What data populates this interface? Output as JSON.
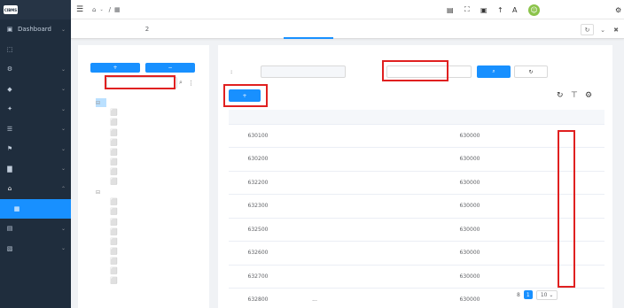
{
  "app": {
    "logo_badge": "CIBMS",
    "name": ""
  },
  "sidebar": {
    "items": [
      {
        "icon": "▣",
        "label": "Dashboard",
        "arrow": "⌄"
      },
      {
        "icon": "⬚",
        "label": ""
      },
      {
        "icon": "⚙",
        "label": "",
        "arrow": "⌄"
      },
      {
        "icon": "◆",
        "label": "",
        "arrow": "⌄"
      },
      {
        "icon": "✦",
        "label": "",
        "arrow": "⌄"
      },
      {
        "icon": "☰",
        "label": "",
        "arrow": "⌄"
      },
      {
        "icon": "⚑",
        "label": "",
        "arrow": "⌄"
      },
      {
        "icon": "▇",
        "label": "",
        "arrow": "⌄"
      },
      {
        "icon": "⌂",
        "label": "",
        "arrow": "⌃"
      },
      {
        "icon": "▦",
        "label": ""
      },
      {
        "icon": "▤",
        "label": "",
        "arrow": "⌄"
      },
      {
        "icon": "▧",
        "label": "",
        "arrow": "⌄"
      }
    ]
  },
  "topbar": {
    "menu_icon": "☰",
    "breadcrumb_home_icon": "⌂",
    "breadcrumb_parent": "",
    "breadcrumb_sep": "/",
    "breadcrumb_current_icon": "▦",
    "breadcrumb_current": "",
    "icons": [
      "▤",
      "⛶",
      "▣",
      "↑",
      "A"
    ],
    "user_avatar": "☺",
    "user_name": "",
    "settings_icon": "⚙"
  },
  "tabs": [
    {
      "label": ""
    },
    {
      "label": "2"
    },
    {
      "label": ""
    },
    {
      "label": ""
    },
    {
      "label": ""
    },
    {
      "label": ""
    },
    {
      "label": ""
    }
  ],
  "tabs_tools": [
    "↻",
    "⌄",
    "✖"
  ],
  "tree": {
    "btn_set": "+ ",
    "btn_clear": "− ",
    "filter_label": "",
    "filter_placeholder": "",
    "search_icon": "⌕",
    "more_icon": "⋮",
    "minus": "⊟",
    "file": "⬜",
    "nodes": [
      {
        "label": "",
        "level": 0
      },
      {
        "label": "",
        "level": 1
      },
      {
        "label": "",
        "level": 1
      },
      {
        "label": "",
        "level": 1
      },
      {
        "label": "",
        "level": 1
      },
      {
        "label": "",
        "level": 1
      },
      {
        "label": "",
        "level": 1
      },
      {
        "label": "",
        "level": 1
      },
      {
        "label": "",
        "level": 1
      },
      {
        "label": "",
        "level": 0
      },
      {
        "label": "",
        "level": 1
      },
      {
        "label": "",
        "level": 1
      },
      {
        "label": "",
        "level": 1
      },
      {
        "label": "",
        "level": 1
      },
      {
        "label": "",
        "level": 1
      },
      {
        "label": "",
        "level": 1
      },
      {
        "label": "",
        "level": 1
      },
      {
        "label": "",
        "level": 1
      },
      {
        "label": "",
        "level": 1
      }
    ]
  },
  "search": {
    "province_label": ":",
    "province_value": "",
    "code_label": "",
    "code_placeholder": "",
    "search_btn": "⌕ ",
    "reset_btn": "↻ "
  },
  "toolbar": {
    "add_btn": "+ ",
    "icons": [
      "↻",
      "⊤",
      "⚙"
    ]
  },
  "table": {
    "headers": [
      "",
      "",
      "",
      "",
      "",
      "",
      ""
    ],
    "rows": [
      {
        "code": "630100",
        "name": "",
        "level": "",
        "status": "",
        "parent_code": "630000",
        "parent_name": ""
      },
      {
        "code": "630200",
        "name": "",
        "level": "",
        "status": "",
        "parent_code": "630000",
        "parent_name": ""
      },
      {
        "code": "632200",
        "name": "",
        "level": "",
        "status": "",
        "parent_code": "630000",
        "parent_name": ""
      },
      {
        "code": "632300",
        "name": "",
        "level": "",
        "status": "",
        "parent_code": "630000",
        "parent_name": ""
      },
      {
        "code": "632500",
        "name": "",
        "level": "",
        "status": "",
        "parent_code": "630000",
        "parent_name": ""
      },
      {
        "code": "632600",
        "name": "",
        "level": "",
        "status": "",
        "parent_code": "630000",
        "parent_name": ""
      },
      {
        "code": "632700",
        "name": "",
        "level": "",
        "status": "",
        "parent_code": "630000",
        "parent_name": ""
      },
      {
        "code": "632800",
        "name": "...",
        "level": "",
        "status": "",
        "parent_code": "630000",
        "parent_name": ""
      }
    ],
    "edit_label": "",
    "detail_label": ""
  },
  "pagination": {
    "total_text": " 8 ",
    "current_page": "1",
    "page_size": "10 ⌄"
  }
}
